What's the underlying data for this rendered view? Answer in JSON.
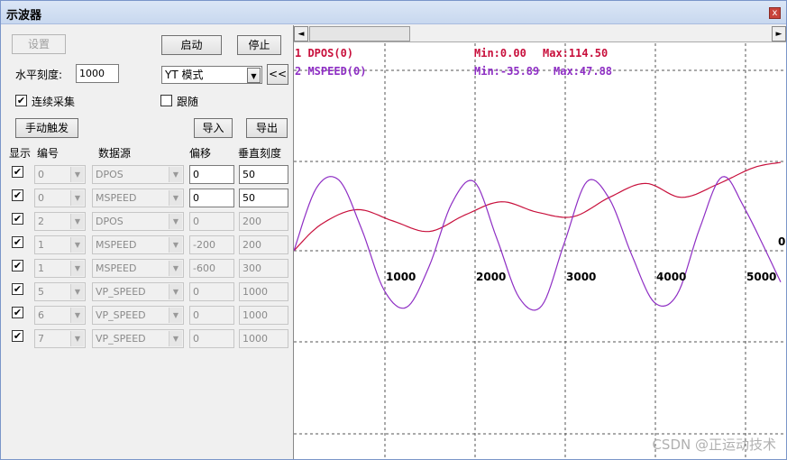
{
  "window": {
    "title": "示波器",
    "close_glyph": "x"
  },
  "controls": {
    "settings_label": "设置",
    "start_label": "启动",
    "stop_label": "停止",
    "hscale_label": "水平刻度:",
    "hscale_value": "1000",
    "mode_value": "YT 模式",
    "collapse_label": "<<",
    "continuous_label": "连续采集",
    "continuous_checked": true,
    "follow_label": "跟随",
    "follow_checked": false,
    "manual_trigger_label": "手动触发",
    "import_label": "导入",
    "export_label": "导出"
  },
  "table": {
    "headers": [
      "显示",
      "编号",
      "数据源",
      "偏移",
      "垂直刻度"
    ],
    "rows": [
      {
        "show": true,
        "num": "0",
        "source": "DPOS",
        "offset": "0",
        "scale": "50",
        "enabled": true
      },
      {
        "show": true,
        "num": "0",
        "source": "MSPEED",
        "offset": "0",
        "scale": "50",
        "enabled": true
      },
      {
        "show": true,
        "num": "2",
        "source": "DPOS",
        "offset": "0",
        "scale": "200",
        "enabled": false
      },
      {
        "show": true,
        "num": "1",
        "source": "MSPEED",
        "offset": "-200",
        "scale": "200",
        "enabled": false
      },
      {
        "show": true,
        "num": "1",
        "source": "MSPEED",
        "offset": "-600",
        "scale": "300",
        "enabled": false
      },
      {
        "show": true,
        "num": "5",
        "source": "VP_SPEED",
        "offset": "0",
        "scale": "1000",
        "enabled": false
      },
      {
        "show": true,
        "num": "6",
        "source": "VP_SPEED",
        "offset": "0",
        "scale": "1000",
        "enabled": false
      },
      {
        "show": true,
        "num": "7",
        "source": "VP_SPEED",
        "offset": "0",
        "scale": "1000",
        "enabled": false
      }
    ]
  },
  "scope": {
    "scroll_left": "◄",
    "scroll_right": "►",
    "legend": [
      {
        "name": "1 DPOS(0)",
        "min": "Min:0.00",
        "max": "Max:114.50",
        "color": "#c8103c"
      },
      {
        "name": "2 MSPEED(0)",
        "min": "Min:-35.89",
        "max": "Max:47.88",
        "color": "#8e2ec4"
      }
    ],
    "x_ticks": [
      "1000",
      "2000",
      "3000",
      "4000",
      "5000"
    ],
    "zero_label": "0",
    "watermark": "CSDN @正运动技术"
  },
  "chart_data": {
    "type": "line",
    "x_ticks": [
      1000,
      2000,
      3000,
      4000,
      5000
    ],
    "series": [
      {
        "name": "1 DPOS(0)",
        "color": "#c8103c",
        "x": [
          0,
          300,
          700,
          1100,
          1500,
          1900,
          2300,
          2700,
          3100,
          3500,
          3900,
          4300,
          4700,
          5100,
          5400
        ],
        "y": [
          0,
          30,
          47,
          34,
          22,
          41,
          56,
          44,
          39,
          61,
          77,
          61,
          76,
          95,
          101
        ]
      },
      {
        "name": "2 MSPEED(0)",
        "color": "#8e2ec4",
        "x": [
          0,
          250,
          500,
          750,
          1000,
          1250,
          1500,
          1750,
          2000,
          2250,
          2500,
          2750,
          3000,
          3250,
          3500,
          3750,
          4000,
          4250,
          4500,
          4750,
          5000,
          5400
        ],
        "y": [
          0,
          40,
          45,
          14,
          -25,
          -36,
          -10,
          30,
          44,
          8,
          -30,
          -35,
          5,
          44,
          33,
          -3,
          -33,
          -28,
          14,
          47,
          27,
          -20
        ]
      }
    ]
  }
}
